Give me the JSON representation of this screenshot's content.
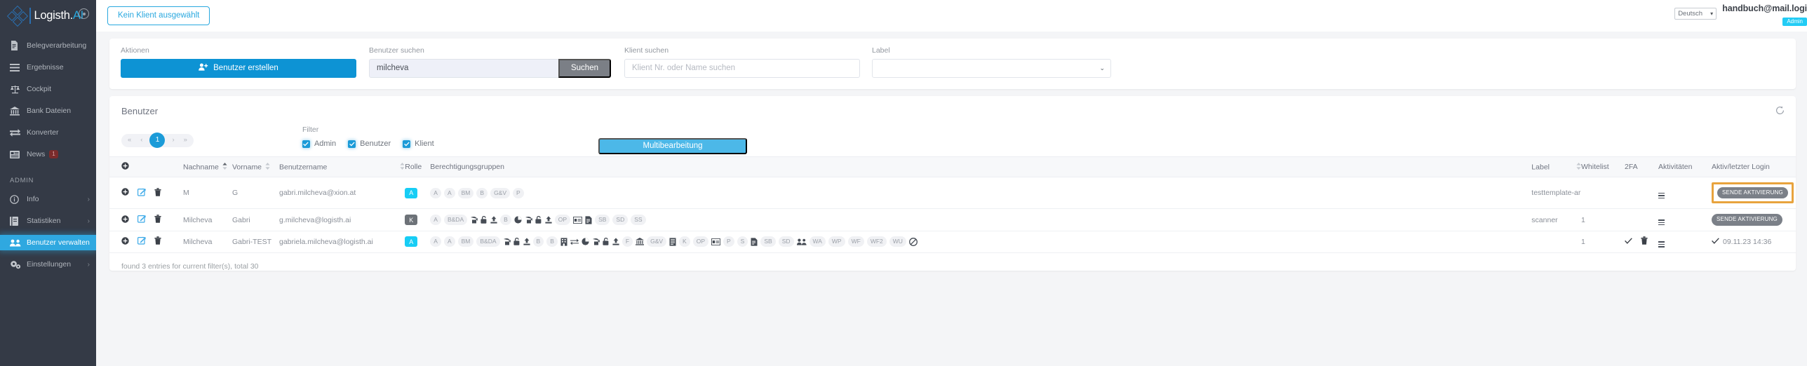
{
  "sidebar": {
    "brand": {
      "name": "Logisth.",
      "accent": "AI"
    },
    "collapse_icon": "collapse-icon",
    "items": [
      {
        "label": "Belegverarbeitung",
        "icon": "document-icon",
        "badge": null,
        "chevron": false
      },
      {
        "label": "Ergebnisse",
        "icon": "list-icon",
        "badge": null,
        "chevron": false
      },
      {
        "label": "Cockpit",
        "icon": "scales-icon",
        "badge": null,
        "chevron": false
      },
      {
        "label": "Bank Dateien",
        "icon": "bank-icon",
        "badge": null,
        "chevron": false
      },
      {
        "label": "Konverter",
        "icon": "exchange-icon",
        "badge": null,
        "chevron": false
      },
      {
        "label": "News",
        "icon": "newspaper-icon",
        "badge": "1",
        "chevron": false
      }
    ],
    "admin_section": "ADMIN",
    "admin_items": [
      {
        "label": "Info",
        "icon": "info-icon",
        "chevron": true,
        "active": false
      },
      {
        "label": "Statistiken",
        "icon": "book-icon",
        "chevron": true,
        "active": false
      },
      {
        "label": "Benutzer verwalten",
        "icon": "users-icon",
        "chevron": false,
        "active": true
      },
      {
        "label": "Einstellungen",
        "icon": "gears-icon",
        "chevron": true,
        "active": false
      }
    ]
  },
  "topbar": {
    "client_button": "Kein Klient ausgewählt",
    "language": "Deutsch",
    "user_email": "handbuch@mail.logi",
    "user_role_badge": "Admin"
  },
  "filters": {
    "actions_label": "Aktionen",
    "create_user_button": "Benutzer erstellen",
    "user_search_label": "Benutzer suchen",
    "user_search_value": "milcheva",
    "search_button": "Suchen",
    "client_search_label": "Klient suchen",
    "client_search_placeholder": "Klient Nr. oder Name suchen",
    "label_label": "Label",
    "label_value": ""
  },
  "users_panel": {
    "title": "Benutzer",
    "refresh_icon": "refresh-icon",
    "pager": {
      "first": "«",
      "prev": "‹",
      "current": "1",
      "next": "›",
      "last": "»"
    },
    "filter_label": "Filter",
    "filter_checkboxes": [
      {
        "label": "Admin",
        "checked": true
      },
      {
        "label": "Benutzer",
        "checked": true
      },
      {
        "label": "Klient",
        "checked": true
      }
    ],
    "multi_edit_button": "Multibearbeitung",
    "footer_text": "found 3 entries for current filter(s), total 30",
    "columns": [
      {
        "label": "",
        "sortable": false
      },
      {
        "label": "Nachname",
        "sortable": true
      },
      {
        "label": "Vorname",
        "sortable": true
      },
      {
        "label": "Benutzername",
        "sortable": true
      },
      {
        "label": "Rolle",
        "sortable": false
      },
      {
        "label": "Berechtigungsgruppen",
        "sortable": false
      },
      {
        "label": "Label",
        "sortable": true
      },
      {
        "label": "Whitelist",
        "sortable": false
      },
      {
        "label": "2FA",
        "sortable": false
      },
      {
        "label": "Aktivitäten",
        "sortable": false
      },
      {
        "label": "Aktiv/letzter Login",
        "sortable": false
      }
    ],
    "rows": [
      {
        "nachname": "M",
        "vorname": "G",
        "benutzername": "gabri.milcheva@xion.at",
        "rolle": "A",
        "rolle_type": "a",
        "gruppen": [
          {
            "t": "chip",
            "v": "A"
          },
          {
            "t": "chip",
            "v": "A"
          },
          {
            "t": "chip",
            "v": "BM"
          },
          {
            "t": "chip",
            "v": "B"
          },
          {
            "t": "chip",
            "v": "G&V"
          },
          {
            "t": "chip",
            "v": "P"
          }
        ],
        "label": "testtemplate-ar",
        "whitelist": "",
        "twofa": "",
        "aktivitaeten": "menu-icon",
        "status_button": "SENDE AKTIVIERUNG",
        "status_highlighted": true,
        "last_login": ""
      },
      {
        "nachname": "Milcheva",
        "vorname": "Gabri",
        "benutzername": "g.milcheva@logisth.ai",
        "rolle": "K",
        "rolle_type": "k",
        "gruppen": [
          {
            "t": "chip",
            "v": "A"
          },
          {
            "t": "chip",
            "v": "B&DA"
          },
          {
            "t": "ico",
            "v": "import-icon"
          },
          {
            "t": "ico",
            "v": "unlock-icon"
          },
          {
            "t": "ico",
            "v": "upload-icon"
          },
          {
            "t": "chip",
            "v": "B"
          },
          {
            "t": "ico",
            "v": "pie-icon"
          },
          {
            "t": "ico",
            "v": "import-icon"
          },
          {
            "t": "ico",
            "v": "unlock-icon"
          },
          {
            "t": "ico",
            "v": "upload-icon"
          },
          {
            "t": "chip",
            "v": "OP"
          },
          {
            "t": "ico",
            "v": "card-icon"
          },
          {
            "t": "ico",
            "v": "doc-icon"
          },
          {
            "t": "chip",
            "v": "SB"
          },
          {
            "t": "chip",
            "v": "SD"
          },
          {
            "t": "chip",
            "v": "SS"
          }
        ],
        "label": "scanner",
        "whitelist": "1",
        "twofa": "",
        "aktivitaeten": "menu-icon",
        "status_button": "SENDE AKTIVIERUNG",
        "status_highlighted": false,
        "last_login": ""
      },
      {
        "nachname": "Milcheva",
        "vorname": "Gabri-TEST",
        "benutzername": "gabriela.milcheva@logisth.ai",
        "rolle": "A",
        "rolle_type": "a",
        "gruppen": [
          {
            "t": "chip",
            "v": "A"
          },
          {
            "t": "chip",
            "v": "A"
          },
          {
            "t": "chip",
            "v": "BM"
          },
          {
            "t": "chip",
            "v": "B&DA"
          },
          {
            "t": "ico",
            "v": "import-icon"
          },
          {
            "t": "ico",
            "v": "unlock-icon"
          },
          {
            "t": "ico",
            "v": "upload-icon"
          },
          {
            "t": "chip",
            "v": "B"
          },
          {
            "t": "chip",
            "v": "B"
          },
          {
            "t": "ico",
            "v": "building-icon"
          },
          {
            "t": "ico",
            "v": "exchange-icon"
          },
          {
            "t": "ico",
            "v": "pie-icon"
          },
          {
            "t": "ico",
            "v": "import-icon"
          },
          {
            "t": "ico",
            "v": "unlock-icon"
          },
          {
            "t": "ico",
            "v": "upload-icon"
          },
          {
            "t": "chip",
            "v": "F"
          },
          {
            "t": "ico",
            "v": "bank-icon"
          },
          {
            "t": "chip",
            "v": "G&V"
          },
          {
            "t": "ico",
            "v": "journal-icon"
          },
          {
            "t": "chip",
            "v": "K"
          },
          {
            "t": "chip",
            "v": "OP"
          },
          {
            "t": "ico",
            "v": "card-icon"
          },
          {
            "t": "chip",
            "v": "P"
          },
          {
            "t": "chip",
            "v": "S"
          },
          {
            "t": "ico",
            "v": "doc-icon"
          },
          {
            "t": "chip",
            "v": "SB"
          },
          {
            "t": "chip",
            "v": "SD"
          },
          {
            "t": "ico",
            "v": "users-icon"
          },
          {
            "t": "chip",
            "v": "WA"
          },
          {
            "t": "chip",
            "v": "WP"
          },
          {
            "t": "chip",
            "v": "WF"
          },
          {
            "t": "chip",
            "v": "WF2"
          },
          {
            "t": "chip",
            "v": "WU"
          },
          {
            "t": "ico",
            "v": "ban-icon"
          }
        ],
        "label": "",
        "whitelist": "1",
        "twofa": "check-and-trash",
        "aktivitaeten": "menu-icon",
        "status_button": "",
        "status_highlighted": false,
        "last_login": "09.11.23 14:36"
      }
    ]
  },
  "colors": {
    "sidebar_bg": "#343a46",
    "accent_blue": "#29a8df",
    "primary_blue": "#0d93d4",
    "role_a": "#17cdf5",
    "role_k": "#6d7278",
    "highlight_orange": "#e8a33d",
    "news_badge": "#7a2b2b"
  }
}
